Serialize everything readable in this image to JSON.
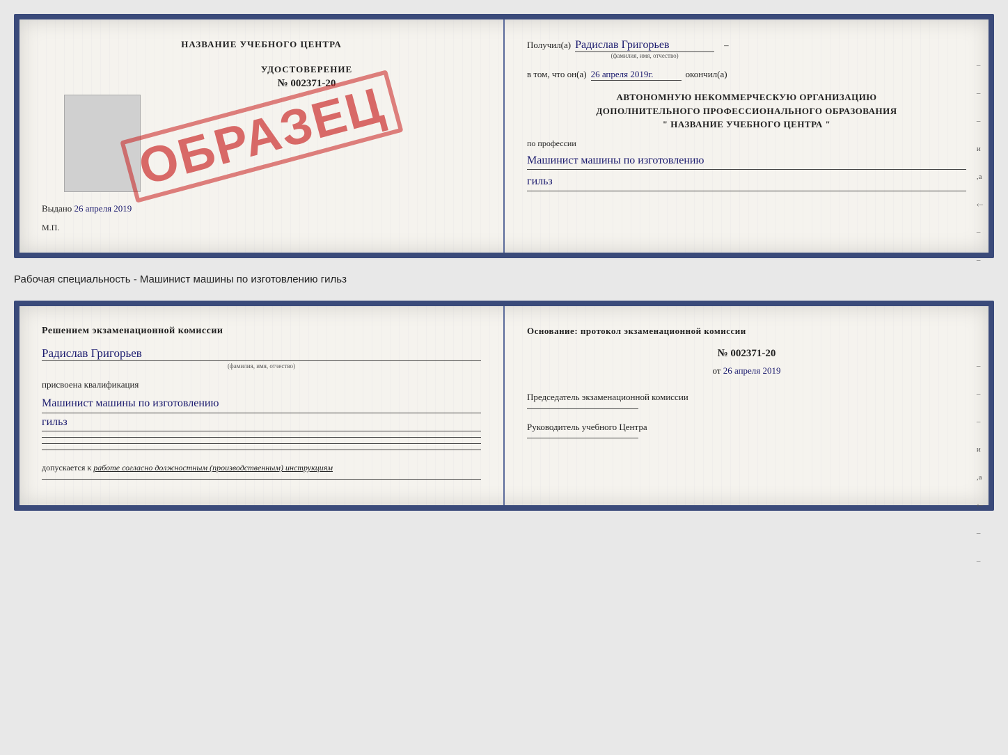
{
  "page": {
    "background_color": "#e8e8e8"
  },
  "specialty_label": "Рабочая специальность - Машинист машины по изготовлению гильз",
  "top_card": {
    "left": {
      "title": "НАЗВАНИЕ УЧЕБНОГО ЦЕНТРА",
      "stamp": "ОБРАЗЕЦ",
      "cert_label": "УДОСТОВЕРЕНИЕ",
      "cert_number": "№ 002371-20",
      "issued_label": "Выдано",
      "issued_date": "26 апреля 2019",
      "mp_label": "М.П."
    },
    "right": {
      "received_label": "Получил(а)",
      "recipient_name": "Радислав Григорьев",
      "name_sublabel": "(фамилия, имя, отчество)",
      "in_that_label": "в том, что он(а)",
      "completion_date": "26 апреля 2019г.",
      "finished_label": "окончил(а)",
      "org_line1": "АВТОНОМНУЮ НЕКОММЕРЧЕСКУЮ ОРГАНИЗАЦИЮ",
      "org_line2": "ДОПОЛНИТЕЛЬНОГО ПРОФЕССИОНАЛЬНОГО ОБРАЗОВАНИЯ",
      "org_line3": "\"  НАЗВАНИЕ УЧЕБНОГО ЦЕНТРА  \"",
      "profession_label": "по профессии",
      "profession_line1": "Машинист машины по изготовлению",
      "profession_line2": "гильз",
      "side_marks": [
        "–",
        "–",
        "–",
        "и",
        ",а",
        "‹–",
        "–",
        "–"
      ]
    }
  },
  "bottom_card": {
    "left": {
      "section_title": "Решением  экзаменационной  комиссии",
      "person_name": "Радислав Григорьев",
      "name_sublabel": "(фамилия, имя, отчество)",
      "assigned_label": "присвоена квалификация",
      "qualification_line1": "Машинист машины по изготовлению",
      "qualification_line2": "гильз",
      "dopusk_text": "допускается к",
      "dopusk_italic": "работе согласно должностным (производственным) инструкциям"
    },
    "right": {
      "foundation_label": "Основание: протокол экзаменационной  комиссии",
      "protocol_number": "№  002371-20",
      "protocol_date_prefix": "от",
      "protocol_date": "26 апреля 2019",
      "chairman_label": "Председатель экзаменационной комиссии",
      "head_label": "Руководитель учебного Центра",
      "side_marks": [
        "–",
        "–",
        "–",
        "и",
        ",а",
        "‹–",
        "–",
        "–"
      ]
    }
  }
}
